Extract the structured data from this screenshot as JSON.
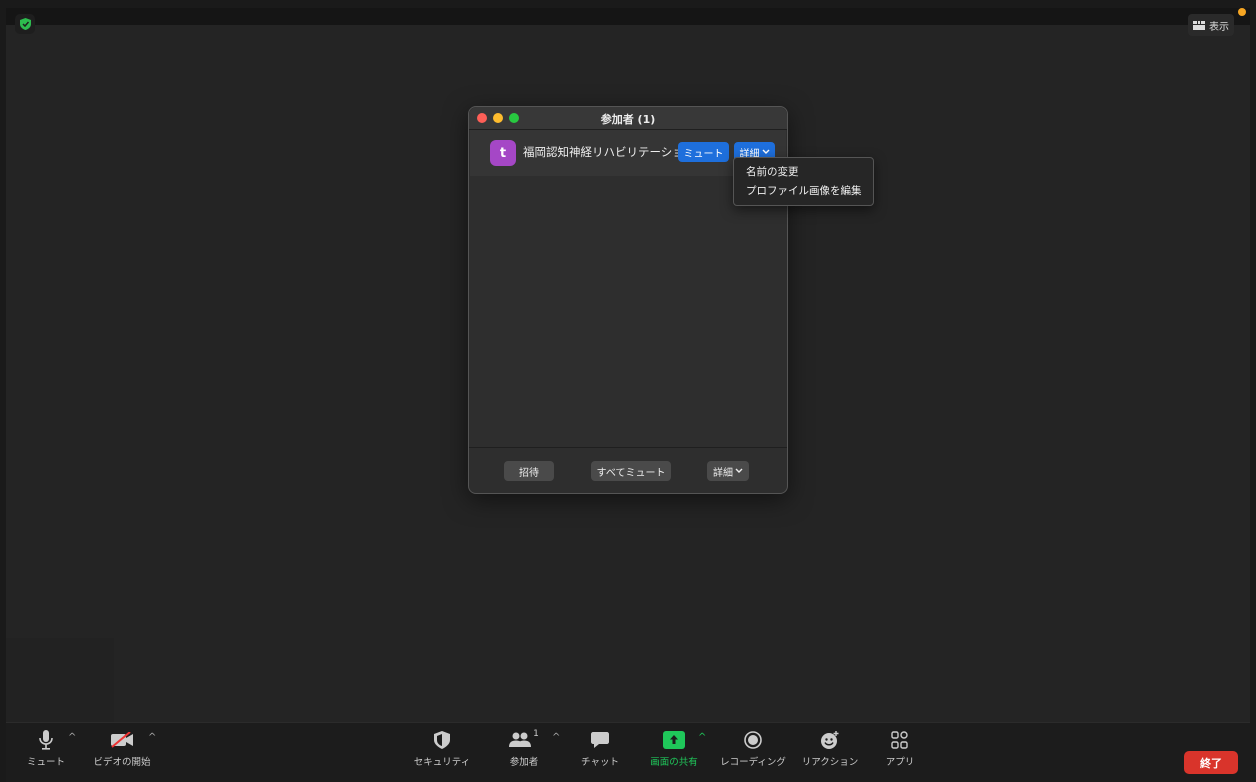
{
  "header": {
    "view_label": "表示"
  },
  "participants_panel": {
    "title": "参加者 (1)",
    "participant": {
      "avatar_letter": "t",
      "name": "福岡認知神経リハビリテーション",
      "mute_label": "ミュート",
      "more_label": "詳細"
    },
    "more_menu": {
      "items": [
        "名前の変更",
        "プロファイル画像を編集"
      ]
    },
    "footer": {
      "invite_label": "招待",
      "mute_all_label": "すべてミュート",
      "more_label": "詳細"
    }
  },
  "toolbar": {
    "mute_label": "ミュート",
    "video_label": "ビデオの開始",
    "security_label": "セキュリティ",
    "participants_label": "参加者",
    "participants_count": "1",
    "chat_label": "チャット",
    "share_label": "画面の共有",
    "record_label": "レコーディング",
    "reactions_label": "リアクション",
    "apps_label": "アプリ",
    "end_label": "終了"
  },
  "colors": {
    "accent_blue": "#1e6fdc",
    "share_green": "#1fc75a",
    "end_red": "#d9342b",
    "avatar_purple": "#a547c6"
  }
}
